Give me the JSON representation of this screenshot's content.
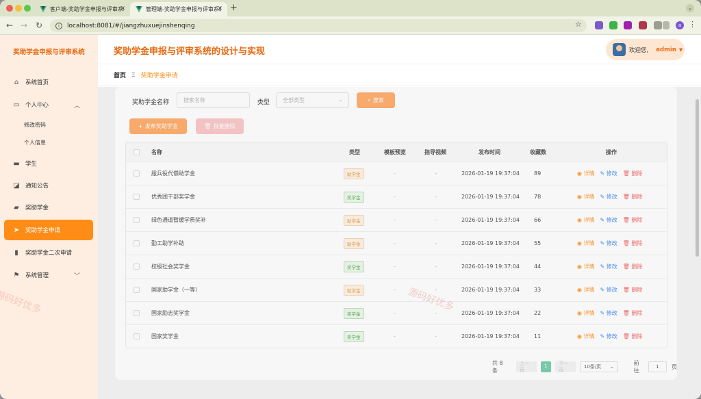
{
  "browser": {
    "tabs": [
      {
        "title": "客户端-奖助学金申报与评审系统"
      },
      {
        "title": "管理端-奖助学金申报与评审系统"
      }
    ],
    "new_tab": "+",
    "url": "localhost:8081/#/jiangzhuxuejinshenqing",
    "profile_initial": "a"
  },
  "sidebar": {
    "brand": "奖助学金申报与评审系统",
    "items": [
      {
        "label": "系统首页",
        "icon": "home-icon"
      },
      {
        "label": "个人中心",
        "icon": "calendar-icon"
      },
      {
        "label": "修改密码"
      },
      {
        "label": "个人信息"
      },
      {
        "label": "学生",
        "icon": "chat-icon"
      },
      {
        "label": "通知公告",
        "icon": "chart-icon"
      },
      {
        "label": "奖助学金",
        "icon": "briefcase-icon"
      },
      {
        "label": "奖助学金申请",
        "icon": "send-icon"
      },
      {
        "label": "奖助学金二次申请",
        "icon": "bar-chart-icon"
      },
      {
        "label": "系统管理",
        "icon": "flag-icon"
      }
    ]
  },
  "header": {
    "title": "奖助学金申报与评审系统的设计与实现",
    "welcome": "欢迎您,",
    "username": "admin"
  },
  "breadcrumb": {
    "home": "首页",
    "separator": "Ξ",
    "current": "奖助学金申请"
  },
  "search": {
    "name_label": "奖助学金名称",
    "name_placeholder": "搜索名称",
    "type_label": "类型",
    "type_placeholder": "全部类型",
    "search_button": "搜索"
  },
  "toolbar": {
    "publish_button": "发布奖助学金",
    "batch_delete_button": "批量删除"
  },
  "table": {
    "columns": [
      "名称",
      "类型",
      "模板预览",
      "指导视频",
      "发布时间",
      "收藏数",
      "操作"
    ],
    "actions": {
      "view": "详情",
      "edit": "修改",
      "delete": "删除"
    },
    "rows": [
      {
        "name": "服兵役代偿助学金",
        "type": "助学金",
        "template": "-",
        "video": "-",
        "time": "2026-01-19 19:37:04",
        "fav": "89"
      },
      {
        "name": "优秀团干部奖学金",
        "type": "奖学金",
        "template": "-",
        "video": "-",
        "time": "2026-01-19 19:37:04",
        "fav": "78"
      },
      {
        "name": "绿色通道暂缓学费奖补",
        "type": "助学金",
        "template": "-",
        "video": "-",
        "time": "2026-01-19 19:37:04",
        "fav": "66"
      },
      {
        "name": "勤工助学补助",
        "type": "助学金",
        "template": "-",
        "video": "-",
        "time": "2026-01-19 19:37:04",
        "fav": "55"
      },
      {
        "name": "校级社会奖学金",
        "type": "奖学金",
        "template": "-",
        "video": "-",
        "time": "2026-01-19 19:37:04",
        "fav": "44"
      },
      {
        "name": "国家助学金（一等）",
        "type": "助学金",
        "template": "-",
        "video": "-",
        "time": "2026-01-19 19:37:04",
        "fav": "33"
      },
      {
        "name": "国家励志奖学金",
        "type": "奖学金",
        "template": "-",
        "video": "-",
        "time": "2026-01-19 19:37:04",
        "fav": "22"
      },
      {
        "name": "国家奖学金",
        "type": "奖学金",
        "template": "-",
        "video": "-",
        "time": "2026-01-19 19:37:04",
        "fav": "11"
      }
    ]
  },
  "pagination": {
    "total": "共 8 条",
    "prev": "上一页",
    "page": "1",
    "next": "下一页",
    "page_size": "10条/页",
    "goto_label": "前往",
    "goto_value": "1",
    "goto_suffix": "页"
  },
  "watermark": "源码好优多",
  "colors": {
    "accent": "#ff8c17",
    "brand": "#e86a11",
    "tag_aid": "#f0a050",
    "tag_scholar": "#5ab55a"
  }
}
